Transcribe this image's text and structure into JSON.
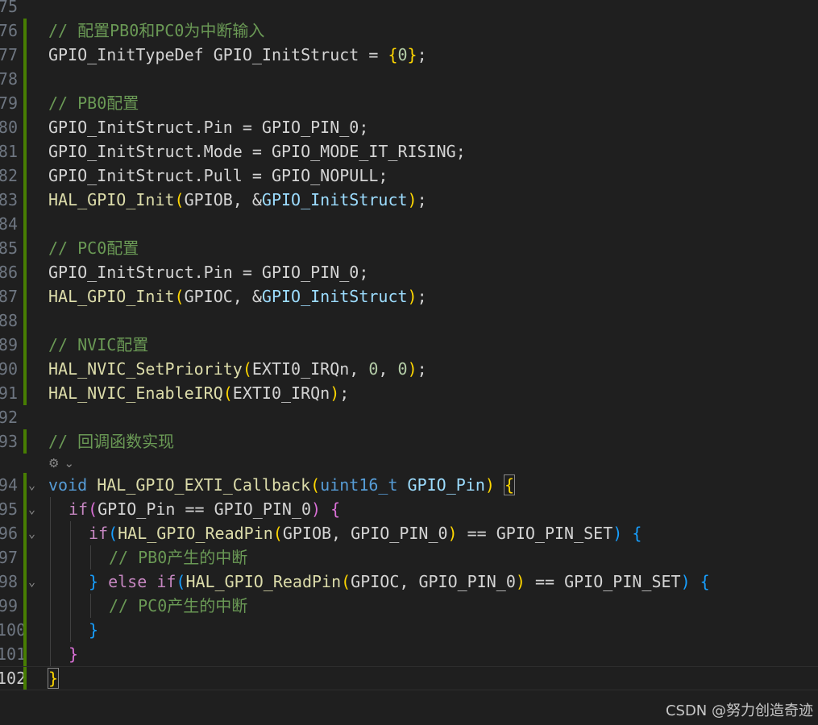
{
  "editor": {
    "lines": [
      {
        "num": "75",
        "bar": false,
        "fold": "",
        "indent": 0,
        "tokens": []
      },
      {
        "num": "76",
        "bar": true,
        "fold": "",
        "indent": 0,
        "tokens": [
          {
            "t": "// 配置PB0和PC0为中断输入",
            "c": "comment"
          }
        ]
      },
      {
        "num": "77",
        "bar": true,
        "fold": "",
        "indent": 0,
        "tokens": [
          {
            "t": "GPIO_InitTypeDef GPIO_InitStruct = ",
            "c": "plain"
          },
          {
            "t": "{",
            "c": "b1"
          },
          {
            "t": "0",
            "c": "number"
          },
          {
            "t": "}",
            "c": "b1"
          },
          {
            "t": ";",
            "c": "plain"
          }
        ]
      },
      {
        "num": "78",
        "bar": true,
        "fold": "",
        "indent": 0,
        "tokens": []
      },
      {
        "num": "79",
        "bar": true,
        "fold": "",
        "indent": 0,
        "tokens": [
          {
            "t": "// PB0配置",
            "c": "comment"
          }
        ]
      },
      {
        "num": "80",
        "bar": true,
        "fold": "",
        "indent": 0,
        "tokens": [
          {
            "t": "GPIO_InitStruct.Pin = GPIO_PIN_0;",
            "c": "plain"
          }
        ]
      },
      {
        "num": "81",
        "bar": true,
        "fold": "",
        "indent": 0,
        "tokens": [
          {
            "t": "GPIO_InitStruct.Mode = GPIO_MODE_IT_RISING;",
            "c": "plain"
          }
        ]
      },
      {
        "num": "82",
        "bar": true,
        "fold": "",
        "indent": 0,
        "tokens": [
          {
            "t": "GPIO_InitStruct.Pull = GPIO_NOPULL;",
            "c": "plain"
          }
        ]
      },
      {
        "num": "83",
        "bar": true,
        "fold": "",
        "indent": 0,
        "tokens": [
          {
            "t": "HAL_GPIO_Init",
            "c": "func"
          },
          {
            "t": "(",
            "c": "b1"
          },
          {
            "t": "GPIOB, &",
            "c": "plain"
          },
          {
            "t": "GPIO_InitStruct",
            "c": "param"
          },
          {
            "t": ")",
            "c": "b1"
          },
          {
            "t": ";",
            "c": "plain"
          }
        ]
      },
      {
        "num": "84",
        "bar": true,
        "fold": "",
        "indent": 0,
        "tokens": []
      },
      {
        "num": "85",
        "bar": true,
        "fold": "",
        "indent": 0,
        "tokens": [
          {
            "t": "// PC0配置",
            "c": "comment"
          }
        ]
      },
      {
        "num": "86",
        "bar": true,
        "fold": "",
        "indent": 0,
        "tokens": [
          {
            "t": "GPIO_InitStruct.Pin = GPIO_PIN_0;",
            "c": "plain"
          }
        ]
      },
      {
        "num": "87",
        "bar": true,
        "fold": "",
        "indent": 0,
        "tokens": [
          {
            "t": "HAL_GPIO_Init",
            "c": "func"
          },
          {
            "t": "(",
            "c": "b1"
          },
          {
            "t": "GPIOC, &",
            "c": "plain"
          },
          {
            "t": "GPIO_InitStruct",
            "c": "param"
          },
          {
            "t": ")",
            "c": "b1"
          },
          {
            "t": ";",
            "c": "plain"
          }
        ]
      },
      {
        "num": "88",
        "bar": true,
        "fold": "",
        "indent": 0,
        "tokens": []
      },
      {
        "num": "89",
        "bar": true,
        "fold": "",
        "indent": 0,
        "tokens": [
          {
            "t": "// NVIC配置",
            "c": "comment"
          }
        ]
      },
      {
        "num": "90",
        "bar": true,
        "fold": "",
        "indent": 0,
        "tokens": [
          {
            "t": "HAL_NVIC_SetPriority",
            "c": "func"
          },
          {
            "t": "(",
            "c": "b1"
          },
          {
            "t": "EXTI0_IRQn, ",
            "c": "plain"
          },
          {
            "t": "0",
            "c": "number"
          },
          {
            "t": ", ",
            "c": "plain"
          },
          {
            "t": "0",
            "c": "number"
          },
          {
            "t": ")",
            "c": "b1"
          },
          {
            "t": ";",
            "c": "plain"
          }
        ]
      },
      {
        "num": "91",
        "bar": true,
        "fold": "",
        "indent": 0,
        "tokens": [
          {
            "t": "HAL_NVIC_EnableIRQ",
            "c": "func"
          },
          {
            "t": "(",
            "c": "b1"
          },
          {
            "t": "EXTI0_IRQn",
            "c": "plain"
          },
          {
            "t": ")",
            "c": "b1"
          },
          {
            "t": ";",
            "c": "plain"
          }
        ]
      },
      {
        "num": "92",
        "bar": false,
        "fold": "",
        "indent": 0,
        "tokens": []
      },
      {
        "num": "93",
        "bar": true,
        "fold": "",
        "indent": 0,
        "tokens": [
          {
            "t": "// 回调函数实现",
            "c": "comment"
          }
        ]
      },
      {
        "codelens": true,
        "icon": "ai-sparkle-icon",
        "glyph": "⚙",
        "chev": "⌄"
      },
      {
        "num": "94",
        "bar": true,
        "fold": "⌄",
        "indent": 0,
        "tokens": [
          {
            "t": "void",
            "c": "keyword"
          },
          {
            "t": " ",
            "c": "plain"
          },
          {
            "t": "HAL_GPIO_EXTI_Callback",
            "c": "func"
          },
          {
            "t": "(",
            "c": "b1"
          },
          {
            "t": "uint16_t",
            "c": "keyword"
          },
          {
            "t": " ",
            "c": "plain"
          },
          {
            "t": "GPIO_Pin",
            "c": "param"
          },
          {
            "t": ")",
            "c": "b1"
          },
          {
            "t": " ",
            "c": "plain"
          },
          {
            "t": "{",
            "c": "b1",
            "m": true
          }
        ]
      },
      {
        "num": "95",
        "bar": true,
        "fold": "⌄",
        "indent": 1,
        "tokens": [
          {
            "t": "if",
            "c": "control"
          },
          {
            "t": "(",
            "c": "b2"
          },
          {
            "t": "GPIO_Pin == GPIO_PIN_0",
            "c": "plain"
          },
          {
            "t": ")",
            "c": "b2"
          },
          {
            "t": " ",
            "c": "plain"
          },
          {
            "t": "{",
            "c": "b2"
          }
        ]
      },
      {
        "num": "96",
        "bar": true,
        "fold": "⌄",
        "indent": 2,
        "tokens": [
          {
            "t": "if",
            "c": "control"
          },
          {
            "t": "(",
            "c": "b3"
          },
          {
            "t": "HAL_GPIO_ReadPin",
            "c": "func"
          },
          {
            "t": "(",
            "c": "b1"
          },
          {
            "t": "GPIOB, GPIO_PIN_0",
            "c": "plain"
          },
          {
            "t": ")",
            "c": "b1"
          },
          {
            "t": " == GPIO_PIN_SET",
            "c": "plain"
          },
          {
            "t": ")",
            "c": "b3"
          },
          {
            "t": " ",
            "c": "plain"
          },
          {
            "t": "{",
            "c": "b3"
          }
        ]
      },
      {
        "num": "97",
        "bar": true,
        "fold": "",
        "indent": 3,
        "tokens": [
          {
            "t": "// PB0产生的中断",
            "c": "comment"
          }
        ]
      },
      {
        "num": "98",
        "bar": true,
        "fold": "⌄",
        "indent": 2,
        "tokens": [
          {
            "t": "}",
            "c": "b3"
          },
          {
            "t": " ",
            "c": "plain"
          },
          {
            "t": "else",
            "c": "control"
          },
          {
            "t": " ",
            "c": "plain"
          },
          {
            "t": "if",
            "c": "control"
          },
          {
            "t": "(",
            "c": "b3"
          },
          {
            "t": "HAL_GPIO_ReadPin",
            "c": "func"
          },
          {
            "t": "(",
            "c": "b1"
          },
          {
            "t": "GPIOC, GPIO_PIN_0",
            "c": "plain"
          },
          {
            "t": ")",
            "c": "b1"
          },
          {
            "t": " == GPIO_PIN_SET",
            "c": "plain"
          },
          {
            "t": ")",
            "c": "b3"
          },
          {
            "t": " ",
            "c": "plain"
          },
          {
            "t": "{",
            "c": "b3"
          }
        ]
      },
      {
        "num": "99",
        "bar": true,
        "fold": "",
        "indent": 3,
        "tokens": [
          {
            "t": "// PC0产生的中断",
            "c": "comment"
          }
        ]
      },
      {
        "num": "100",
        "bar": true,
        "fold": "",
        "indent": 2,
        "tokens": [
          {
            "t": "}",
            "c": "b3"
          }
        ]
      },
      {
        "num": "101",
        "bar": true,
        "fold": "",
        "indent": 1,
        "tokens": [
          {
            "t": "}",
            "c": "b2"
          }
        ]
      },
      {
        "num": "102",
        "bar": true,
        "fold": "",
        "indent": 0,
        "active": true,
        "tokens": [
          {
            "t": "}",
            "c": "b1",
            "m": true
          }
        ]
      }
    ]
  },
  "watermark": {
    "text": "CSDN @努力创造奇迹"
  },
  "colors": {
    "background": "#1f1f1f",
    "gutter_bar": "#487e02",
    "comment": "#6a9955",
    "keyword": "#569cd6",
    "control": "#c586c0",
    "function": "#dcdcaa",
    "parameter": "#9cdcfe",
    "number": "#b5cea8",
    "bracket_1": "#ffd700",
    "bracket_2": "#da70d6",
    "bracket_3": "#179fff"
  }
}
